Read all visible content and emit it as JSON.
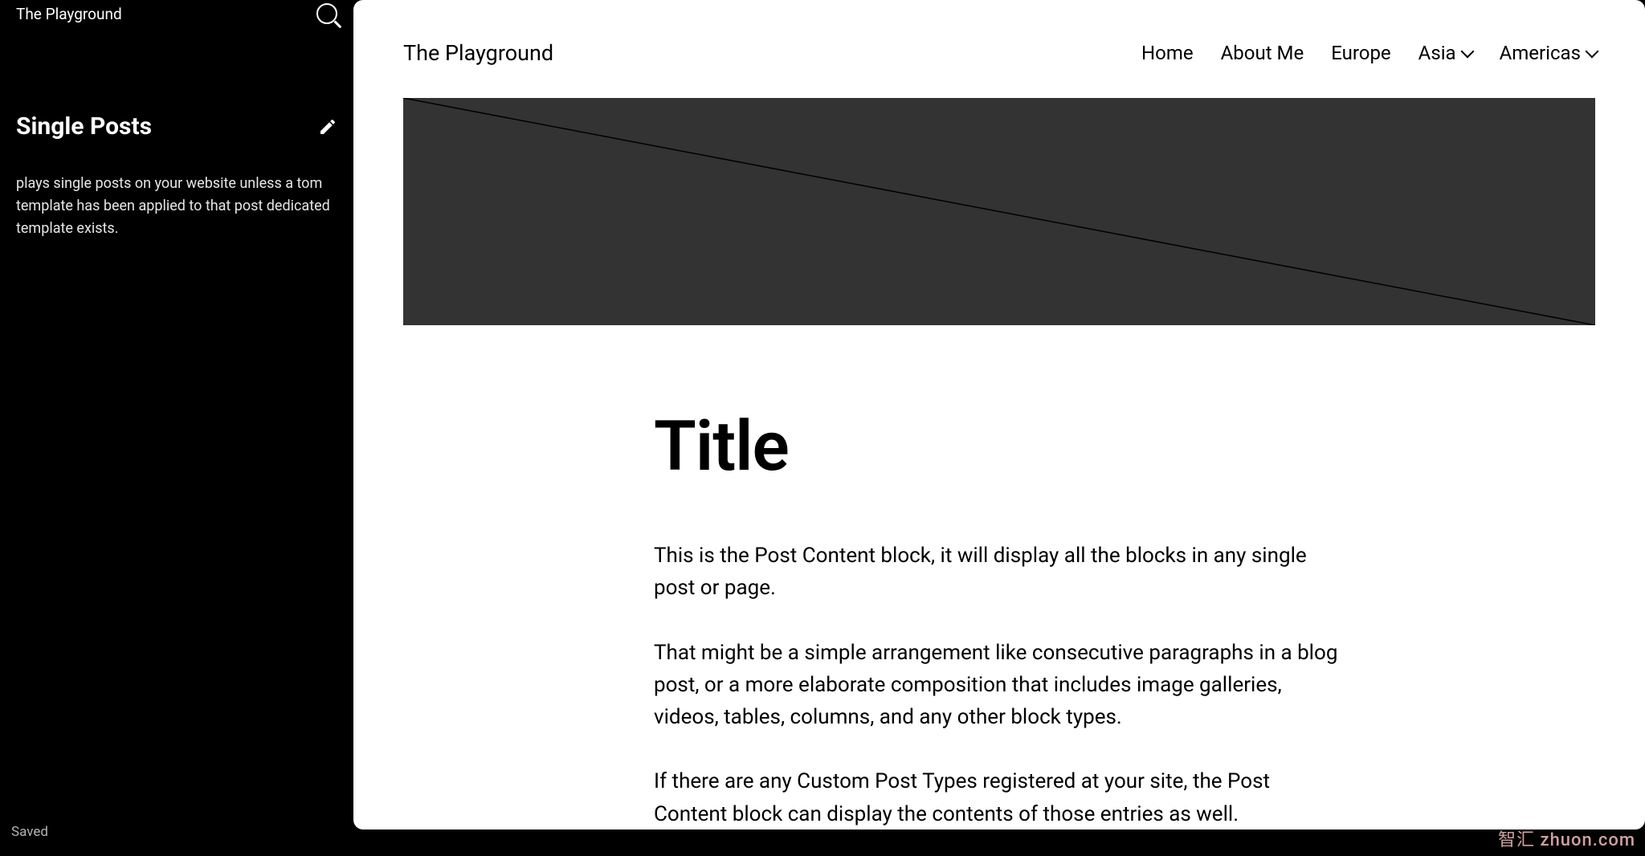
{
  "sidebar": {
    "site_name": "The Playground",
    "section_title": "Single Posts",
    "description": "plays single posts on your website unless a tom template has been applied to that post dedicated template exists.",
    "status": "Saved"
  },
  "header": {
    "site_title": "The Playground",
    "nav": [
      "Home",
      "About Me",
      "Europe",
      "Asia",
      "Americas"
    ]
  },
  "post": {
    "title": "Title",
    "paragraphs": [
      "This is the Post Content block, it will display all the blocks in any single post or page.",
      "That might be a simple arrangement like consecutive paragraphs in a blog post, or a more elaborate composition that includes image galleries, videos, tables, columns, and any other block types.",
      "If there are any Custom Post Types registered at your site, the Post Content block can display the contents of those entries as well."
    ]
  },
  "watermark": "智汇 zhuon.com"
}
